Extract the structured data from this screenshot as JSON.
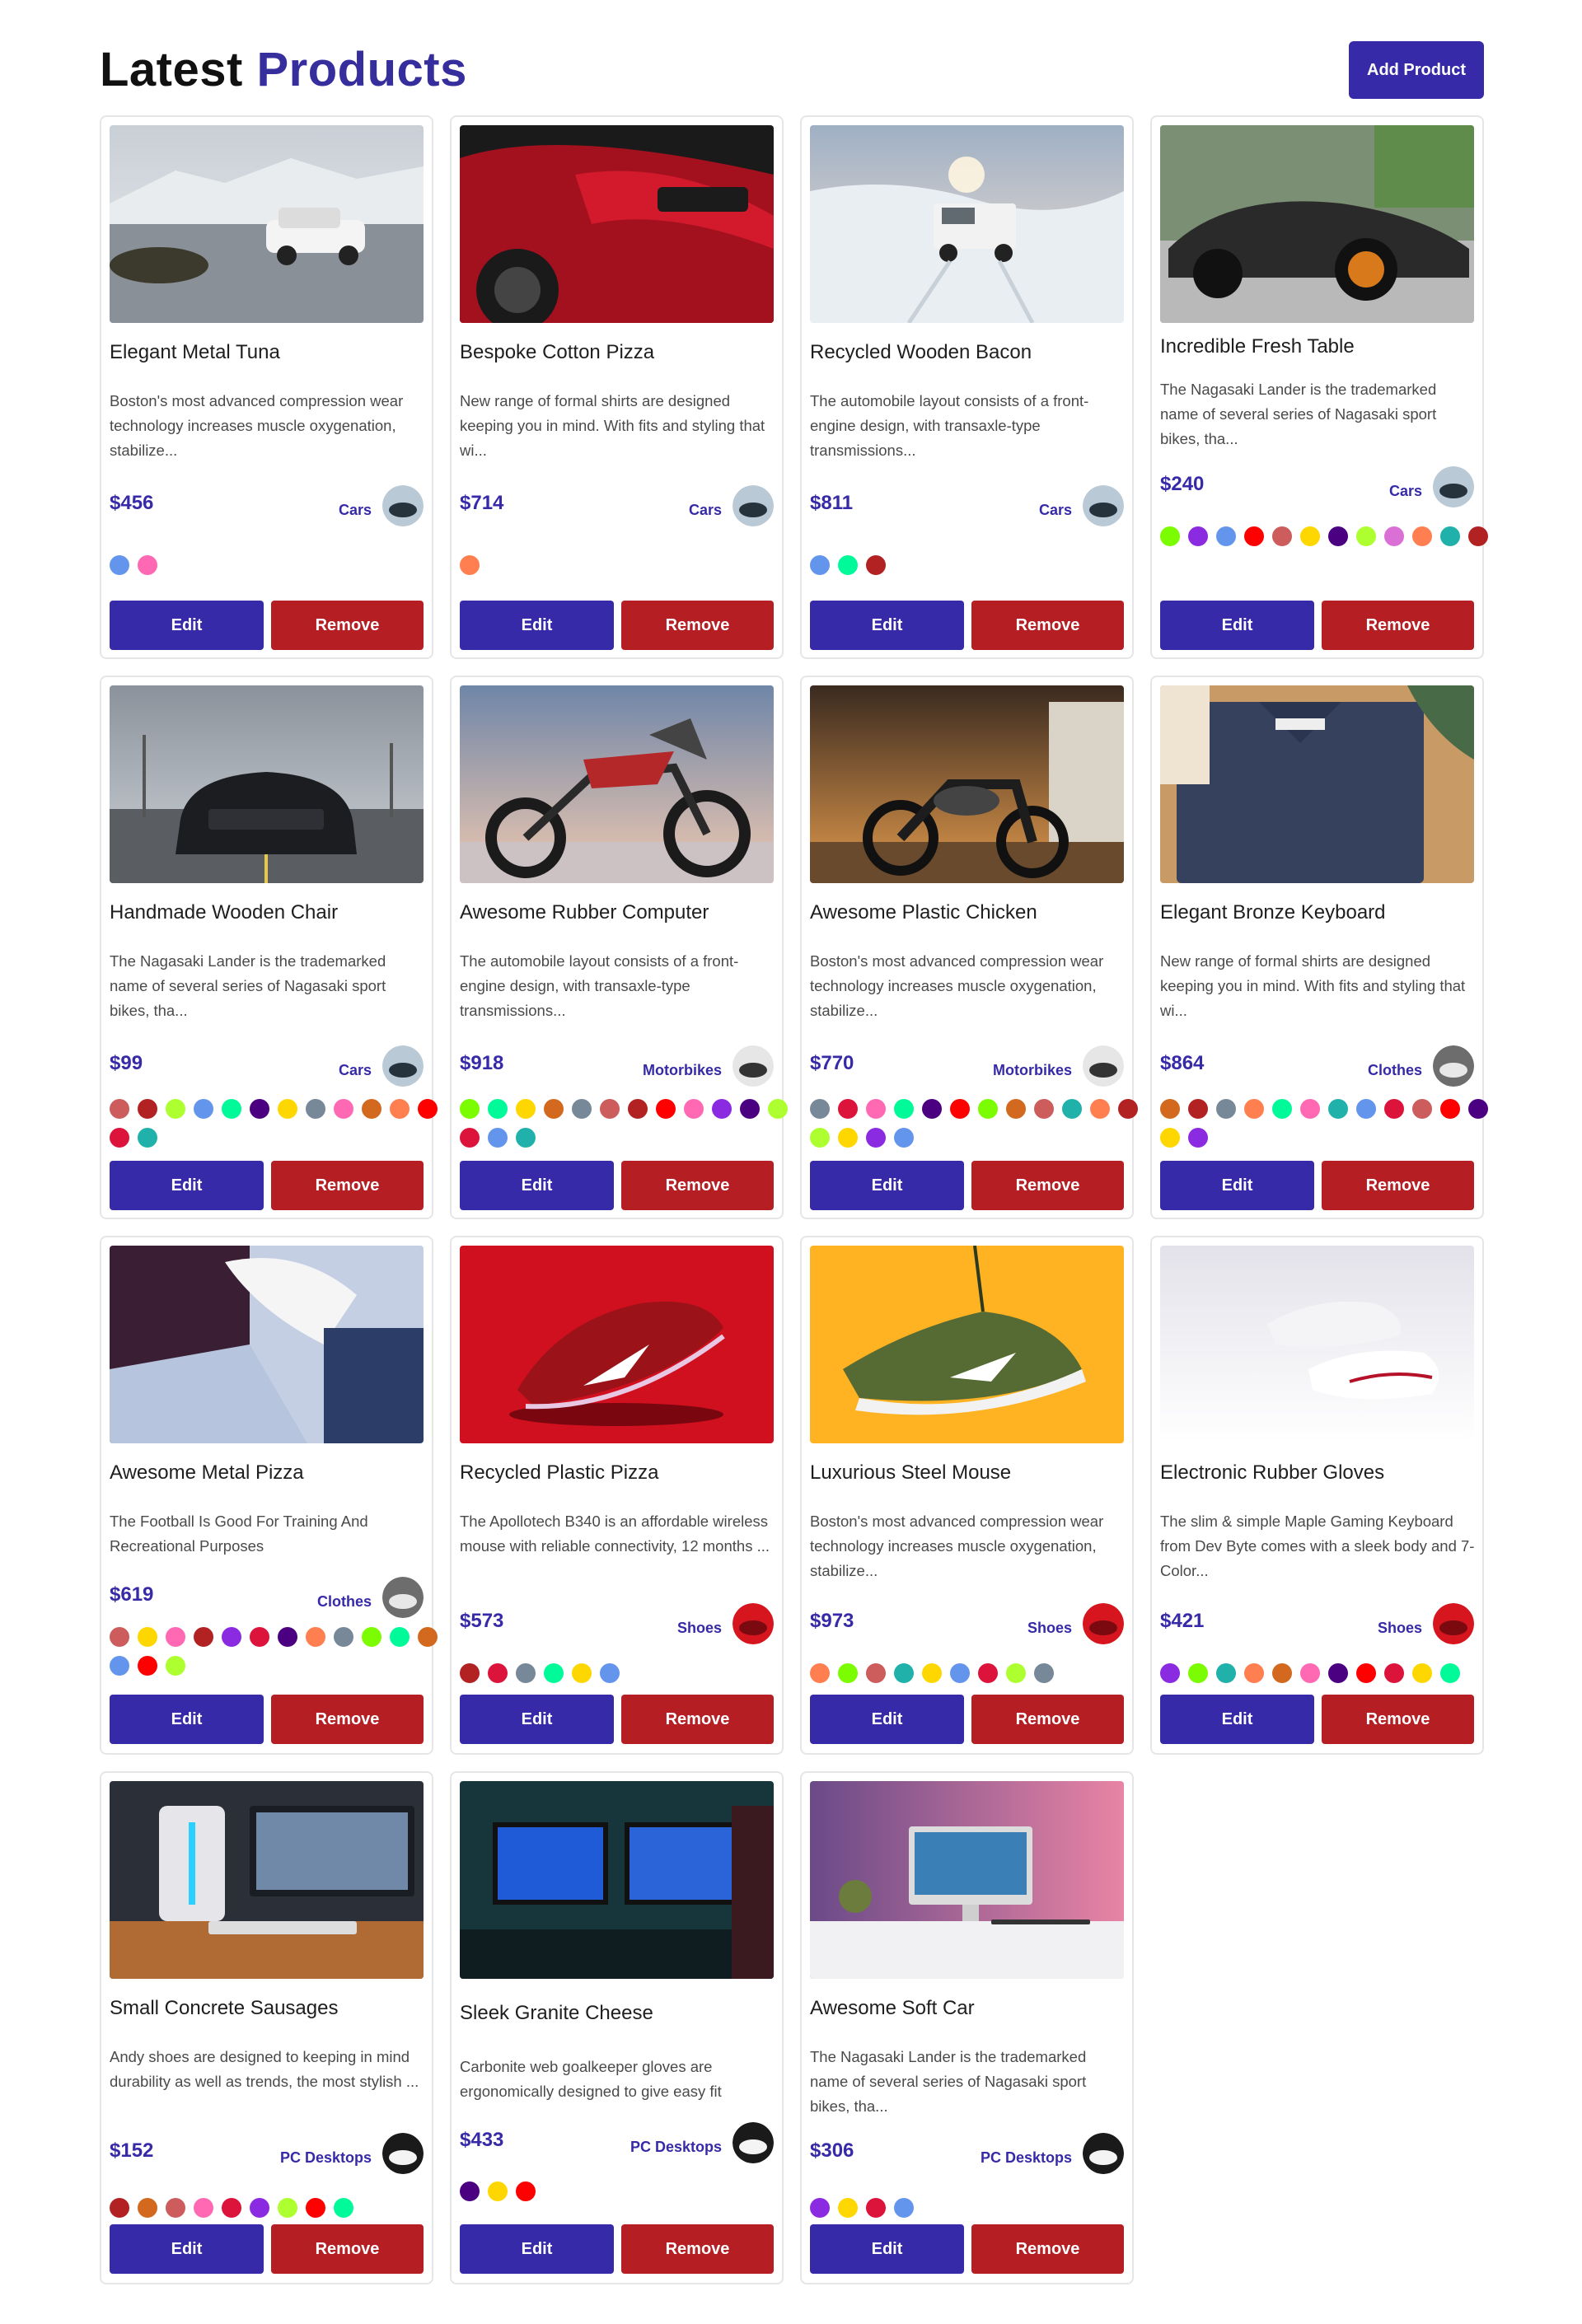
{
  "header": {
    "title_word1": "Latest",
    "title_word2": "Products",
    "add_button": "Add Product"
  },
  "colors": {
    "accent": "#372aa8",
    "remove": "#b51f24"
  },
  "cards": [
    {
      "name": "Elegant Metal Tuna",
      "description": "Boston's most advanced compression wear technology increases muscle oxygenation, stabilize...",
      "price": "$456",
      "category": "Cars",
      "image": "car-snow-suv",
      "colors": [
        "#6495ed",
        "#ff69b4"
      ],
      "edit_label": "Edit",
      "remove_label": "Remove"
    },
    {
      "name": "Bespoke Cotton Pizza",
      "description": "New range of formal shirts are designed keeping you in mind. With fits and styling that wi...",
      "price": "$714",
      "category": "Cars",
      "image": "red-sports-car",
      "colors": [
        "#ff7f50"
      ],
      "edit_label": "Edit",
      "remove_label": "Remove"
    },
    {
      "name": "Recycled Wooden Bacon",
      "description": "The automobile layout consists of a front-engine design, with transaxle-type transmissions...",
      "price": "$811",
      "category": "Cars",
      "image": "jeep-snow",
      "colors": [
        "#6495ed",
        "#00fa9a",
        "#b22222"
      ],
      "edit_label": "Edit",
      "remove_label": "Remove"
    },
    {
      "name": "Incredible Fresh Table",
      "description": "The Nagasaki Lander is the trademarked name of several series of Nagasaki sport bikes, tha...",
      "price": "$240",
      "category": "Cars",
      "image": "black-supercar",
      "colors": [
        "#7cfc00",
        "#8a2be2",
        "#6495ed",
        "#ff0000",
        "#cd5c5c",
        "#ffd700",
        "#4b0082",
        "#adff2f",
        "#da70d6",
        "#ff7f50",
        "#20b2aa",
        "#b22222"
      ],
      "edit_label": "Edit",
      "remove_label": "Remove"
    },
    {
      "name": "Handmade Wooden Chair",
      "description": "The Nagasaki Lander is the trademarked name of several series of Nagasaki sport bikes, tha...",
      "price": "$99",
      "category": "Cars",
      "image": "black-mustang",
      "colors": [
        "#cd5c5c",
        "#b22222",
        "#adff2f",
        "#6495ed",
        "#00fa9a",
        "#4b0082",
        "#ffd700",
        "#778899",
        "#ff69b4",
        "#d2691e",
        "#ff7f50",
        "#ff0000",
        "#dc143c",
        "#20b2aa"
      ],
      "edit_label": "Edit",
      "remove_label": "Remove"
    },
    {
      "name": "Awesome Rubber Computer",
      "description": "The automobile layout consists of a front-engine design, with transaxle-type transmissions...",
      "price": "$918",
      "category": "Motorbikes",
      "image": "dirt-bike",
      "colors": [
        "#7cfc00",
        "#00fa9a",
        "#ffd700",
        "#d2691e",
        "#778899",
        "#cd5c5c",
        "#b22222",
        "#ff0000",
        "#ff69b4",
        "#8a2be2",
        "#4b0082",
        "#adff2f",
        "#dc143c",
        "#6495ed",
        "#20b2aa"
      ],
      "edit_label": "Edit",
      "remove_label": "Remove"
    },
    {
      "name": "Awesome Plastic Chicken",
      "description": "Boston's most advanced compression wear technology increases muscle oxygenation, stabilize...",
      "price": "$770",
      "category": "Motorbikes",
      "image": "cruiser-motorbike",
      "colors": [
        "#778899",
        "#dc143c",
        "#ff69b4",
        "#00fa9a",
        "#4b0082",
        "#ff0000",
        "#7cfc00",
        "#d2691e",
        "#cd5c5c",
        "#20b2aa",
        "#ff7f50",
        "#b22222",
        "#adff2f",
        "#ffd700",
        "#8a2be2",
        "#6495ed"
      ],
      "edit_label": "Edit",
      "remove_label": "Remove"
    },
    {
      "name": "Elegant Bronze Keyboard",
      "description": "New range of formal shirts are designed keeping you in mind. With fits and styling that wi...",
      "price": "$864",
      "category": "Clothes",
      "image": "folded-shirt",
      "colors": [
        "#d2691e",
        "#b22222",
        "#778899",
        "#ff7f50",
        "#00fa9a",
        "#ff69b4",
        "#20b2aa",
        "#6495ed",
        "#dc143c",
        "#cd5c5c",
        "#ff0000",
        "#4b0082",
        "#ffd700",
        "#8a2be2"
      ],
      "edit_label": "Edit",
      "remove_label": "Remove"
    },
    {
      "name": "Awesome Metal Pizza",
      "description": "The Football Is Good For Training And Recreational Purposes",
      "price": "$619",
      "category": "Clothes",
      "image": "shirts-pile",
      "colors": [
        "#cd5c5c",
        "#ffd700",
        "#ff69b4",
        "#b22222",
        "#8a2be2",
        "#dc143c",
        "#4b0082",
        "#ff7f50",
        "#778899",
        "#7cfc00",
        "#00fa9a",
        "#d2691e",
        "#6495ed",
        "#ff0000",
        "#adff2f"
      ],
      "edit_label": "Edit",
      "remove_label": "Remove"
    },
    {
      "name": "Recycled Plastic Pizza",
      "description": "The Apollotech B340 is an affordable wireless mouse with reliable connectivity, 12 months ...",
      "price": "$573",
      "category": "Shoes",
      "image": "red-sneaker",
      "colors": [
        "#b22222",
        "#dc143c",
        "#778899",
        "#00fa9a",
        "#ffd700",
        "#6495ed"
      ],
      "edit_label": "Edit",
      "remove_label": "Remove"
    },
    {
      "name": "Luxurious Steel Mouse",
      "description": "Boston's most advanced compression wear technology increases muscle oxygenation, stabilize...",
      "price": "$973",
      "category": "Shoes",
      "image": "green-sneaker",
      "colors": [
        "#ff7f50",
        "#7cfc00",
        "#cd5c5c",
        "#20b2aa",
        "#ffd700",
        "#6495ed",
        "#dc143c",
        "#adff2f",
        "#778899"
      ],
      "edit_label": "Edit",
      "remove_label": "Remove"
    },
    {
      "name": "Electronic Rubber Gloves",
      "description": "The slim & simple Maple Gaming Keyboard from Dev Byte comes with a sleek body and 7- Color...",
      "price": "$421",
      "category": "Shoes",
      "image": "white-sneakers",
      "colors": [
        "#8a2be2",
        "#7cfc00",
        "#20b2aa",
        "#ff7f50",
        "#d2691e",
        "#ff69b4",
        "#4b0082",
        "#ff0000",
        "#dc143c",
        "#ffd700",
        "#00fa9a"
      ],
      "edit_label": "Edit",
      "remove_label": "Remove"
    },
    {
      "name": "Small Concrete Sausages",
      "description": "Andy shoes are designed to keeping in mind durability as well as trends, the most stylish ...",
      "price": "$152",
      "category": "PC Desktops",
      "image": "gaming-pc",
      "colors": [
        "#b22222",
        "#d2691e",
        "#cd5c5c",
        "#ff69b4",
        "#dc143c",
        "#8a2be2",
        "#adff2f",
        "#ff0000",
        "#00fa9a"
      ],
      "edit_label": "Edit",
      "remove_label": "Remove"
    },
    {
      "name": "Sleek Granite Cheese",
      "description": "Carbonite web goalkeeper gloves are ergonomically designed to give easy fit",
      "price": "$433",
      "category": "PC Desktops",
      "image": "dual-monitor-setup",
      "colors": [
        "#4b0082",
        "#ffd700",
        "#ff0000"
      ],
      "edit_label": "Edit",
      "remove_label": "Remove"
    },
    {
      "name": "Awesome Soft Car",
      "description": "The Nagasaki Lander is the trademarked name of several series of Nagasaki sport bikes, tha...",
      "price": "$306",
      "category": "PC Desktops",
      "image": "imac-desk",
      "colors": [
        "#8a2be2",
        "#ffd700",
        "#dc143c",
        "#6495ed"
      ],
      "edit_label": "Edit",
      "remove_label": "Remove"
    }
  ]
}
